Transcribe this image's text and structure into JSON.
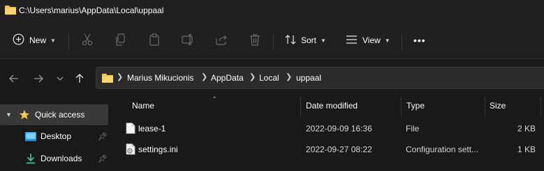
{
  "window": {
    "title": "C:\\Users\\marius\\AppData\\Local\\uppaal"
  },
  "toolbar": {
    "new_label": "New",
    "sort_label": "Sort",
    "view_label": "View",
    "more_label": "•••"
  },
  "address": {
    "crumbs": [
      "Marius Mikucionis",
      "AppData",
      "Local",
      "uppaal"
    ]
  },
  "navpane": {
    "items": [
      {
        "label": "Quick access",
        "icon": "star-icon"
      },
      {
        "label": "Desktop",
        "icon": "desktop-icon"
      },
      {
        "label": "Downloads",
        "icon": "download-icon"
      }
    ]
  },
  "filelist": {
    "columns": [
      "Name",
      "Date modified",
      "Type",
      "Size"
    ],
    "rows": [
      {
        "name": "lease-1",
        "date": "2022-09-09 16:36",
        "type": "File",
        "size": "2 KB",
        "icon": "file-icon"
      },
      {
        "name": "settings.ini",
        "date": "2022-09-27 08:22",
        "type": "Configuration sett...",
        "size": "1 KB",
        "icon": "settings-file-icon"
      }
    ]
  },
  "colors": {
    "background": "#191919",
    "chrome": "#202020",
    "selected": "#383838",
    "folder": "#f2c55c",
    "star": "#f7c948",
    "accent": "#4cc2ff"
  }
}
